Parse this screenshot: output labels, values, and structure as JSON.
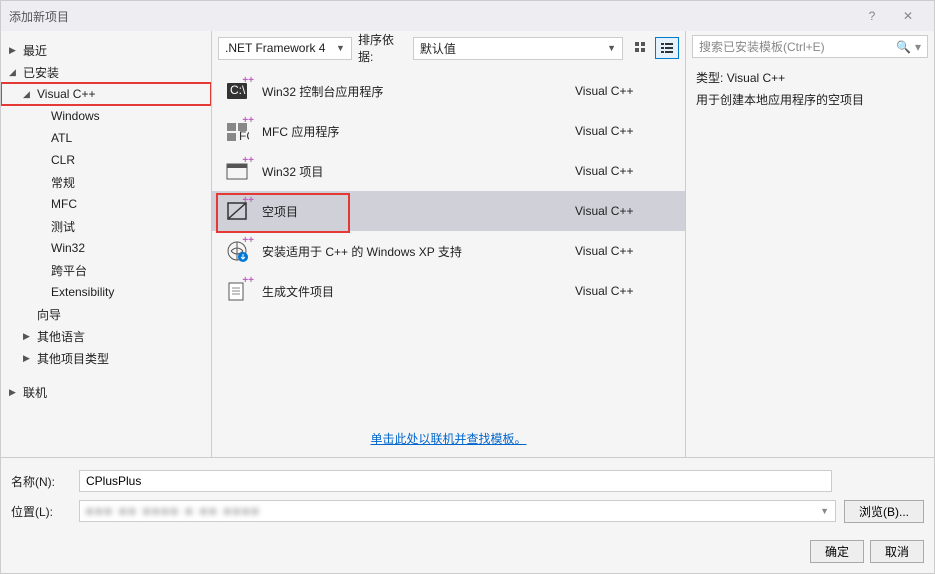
{
  "title": "添加新项目",
  "sidebar": {
    "items": [
      {
        "label": "最近",
        "arrow": "▶",
        "depth": 0
      },
      {
        "label": "已安装",
        "arrow": "◢",
        "depth": 0
      },
      {
        "label": "Visual C++",
        "arrow": "◢",
        "depth": 1,
        "selected": true,
        "red": true
      },
      {
        "label": "Windows",
        "arrow": "",
        "depth": 2
      },
      {
        "label": "ATL",
        "arrow": "",
        "depth": 2
      },
      {
        "label": "CLR",
        "arrow": "",
        "depth": 2
      },
      {
        "label": "常规",
        "arrow": "",
        "depth": 2
      },
      {
        "label": "MFC",
        "arrow": "",
        "depth": 2
      },
      {
        "label": "测试",
        "arrow": "",
        "depth": 2
      },
      {
        "label": "Win32",
        "arrow": "",
        "depth": 2
      },
      {
        "label": "跨平台",
        "arrow": "",
        "depth": 2
      },
      {
        "label": "Extensibility",
        "arrow": "",
        "depth": 2
      },
      {
        "label": "向导",
        "arrow": "",
        "depth": 1
      },
      {
        "label": "其他语言",
        "arrow": "▶",
        "depth": 1
      },
      {
        "label": "其他项目类型",
        "arrow": "▶",
        "depth": 1
      },
      {
        "label": "联机",
        "arrow": "▶",
        "depth": 0
      }
    ]
  },
  "toolbar": {
    "framework": ".NET Framework 4",
    "sort_label": "排序依据:",
    "sort_value": "默认值"
  },
  "templates": [
    {
      "name": "Win32 控制台应用程序",
      "lang": "Visual C++",
      "icon": "console"
    },
    {
      "name": "MFC 应用程序",
      "lang": "Visual C++",
      "icon": "mfc"
    },
    {
      "name": "Win32 项目",
      "lang": "Visual C++",
      "icon": "win32"
    },
    {
      "name": "空项目",
      "lang": "Visual C++",
      "icon": "empty",
      "selected": true,
      "red": true
    },
    {
      "name": "安装适用于 C++ 的 Windows XP 支持",
      "lang": "Visual C++",
      "icon": "download"
    },
    {
      "name": "生成文件项目",
      "lang": "Visual C++",
      "icon": "makefile"
    }
  ],
  "online_link": "单击此处以联机并查找模板。",
  "search": {
    "placeholder": "搜索已安装模板(Ctrl+E)"
  },
  "detail": {
    "type_label": "类型:",
    "type_value": "Visual C++",
    "description": "用于创建本地应用程序的空项目"
  },
  "bottom": {
    "name_label": "名称(N):",
    "name_value": "CPlusPlus",
    "location_label": "位置(L):",
    "location_value": "■■■ ■■ ■■■■ ■ ■■ ■■■■",
    "browse": "浏览(B)...",
    "ok": "确定",
    "cancel": "取消"
  }
}
